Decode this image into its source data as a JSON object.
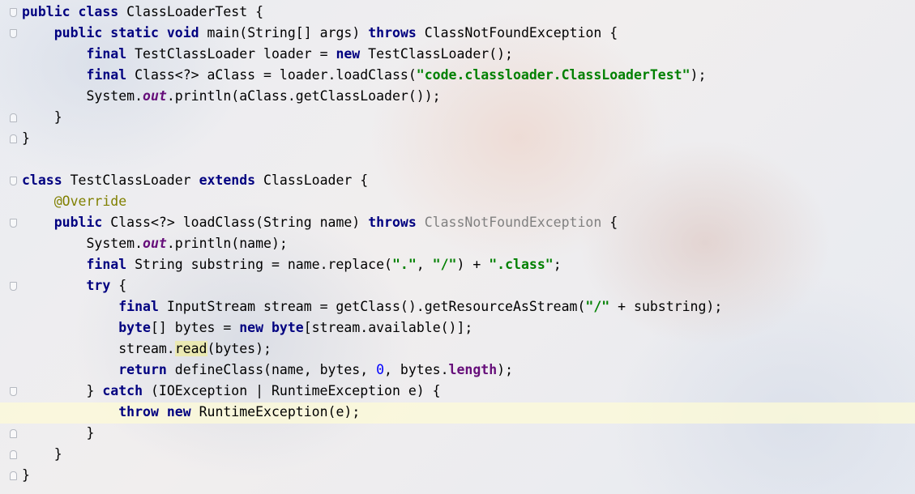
{
  "editor": {
    "highlighted_line": 19,
    "lines": [
      {
        "tokens": [
          {
            "t": "public",
            "c": "kw"
          },
          {
            "t": " "
          },
          {
            "t": "class",
            "c": "kw"
          },
          {
            "t": " ClassLoaderTest {"
          }
        ]
      },
      {
        "tokens": [
          {
            "t": "    "
          },
          {
            "t": "public",
            "c": "kw"
          },
          {
            "t": " "
          },
          {
            "t": "static",
            "c": "kw"
          },
          {
            "t": " "
          },
          {
            "t": "void",
            "c": "kw"
          },
          {
            "t": " main(String[] args) "
          },
          {
            "t": "throws",
            "c": "kw"
          },
          {
            "t": " ClassNotFoundException {"
          }
        ]
      },
      {
        "tokens": [
          {
            "t": "        "
          },
          {
            "t": "final",
            "c": "kw"
          },
          {
            "t": " TestClassLoader loader = "
          },
          {
            "t": "new",
            "c": "kw"
          },
          {
            "t": " TestClassLoader();"
          }
        ]
      },
      {
        "tokens": [
          {
            "t": "        "
          },
          {
            "t": "final",
            "c": "kw"
          },
          {
            "t": " Class<?> aClass = loader.loadClass("
          },
          {
            "t": "\"code.classloader.ClassLoaderTest\"",
            "c": "str"
          },
          {
            "t": ");"
          }
        ]
      },
      {
        "tokens": [
          {
            "t": "        System."
          },
          {
            "t": "out",
            "c": "stat"
          },
          {
            "t": ".println(aClass.getClassLoader());"
          }
        ]
      },
      {
        "tokens": [
          {
            "t": "    }"
          }
        ]
      },
      {
        "tokens": [
          {
            "t": "}"
          }
        ]
      },
      {
        "tokens": []
      },
      {
        "tokens": [
          {
            "t": "class",
            "c": "kw"
          },
          {
            "t": " TestClassLoader "
          },
          {
            "t": "extends",
            "c": "kw"
          },
          {
            "t": " ClassLoader {"
          }
        ]
      },
      {
        "tokens": [
          {
            "t": "    "
          },
          {
            "t": "@Override",
            "c": "ann"
          }
        ]
      },
      {
        "tokens": [
          {
            "t": "    "
          },
          {
            "t": "public",
            "c": "kw"
          },
          {
            "t": " Class<?> loadClass(String name) "
          },
          {
            "t": "throws",
            "c": "kw"
          },
          {
            "t": " "
          },
          {
            "t": "ClassNotFoundException",
            "c": "muted"
          },
          {
            "t": " {"
          }
        ]
      },
      {
        "tokens": [
          {
            "t": "        System."
          },
          {
            "t": "out",
            "c": "stat"
          },
          {
            "t": ".println(name);"
          }
        ]
      },
      {
        "tokens": [
          {
            "t": "        "
          },
          {
            "t": "final",
            "c": "kw"
          },
          {
            "t": " String substring = name.replace("
          },
          {
            "t": "\".\"",
            "c": "str"
          },
          {
            "t": ", "
          },
          {
            "t": "\"/\"",
            "c": "str"
          },
          {
            "t": ") + "
          },
          {
            "t": "\".class\"",
            "c": "str"
          },
          {
            "t": ";"
          }
        ]
      },
      {
        "tokens": [
          {
            "t": "        "
          },
          {
            "t": "try",
            "c": "kw"
          },
          {
            "t": " {"
          }
        ]
      },
      {
        "tokens": [
          {
            "t": "            "
          },
          {
            "t": "final",
            "c": "kw"
          },
          {
            "t": " InputStream stream = getClass().getResourceAsStream("
          },
          {
            "t": "\"/\"",
            "c": "str"
          },
          {
            "t": " + substring);"
          }
        ]
      },
      {
        "tokens": [
          {
            "t": "            "
          },
          {
            "t": "byte",
            "c": "kw"
          },
          {
            "t": "[] bytes = "
          },
          {
            "t": "new",
            "c": "kw"
          },
          {
            "t": " "
          },
          {
            "t": "byte",
            "c": "kw"
          },
          {
            "t": "[stream.available()];"
          }
        ]
      },
      {
        "tokens": [
          {
            "t": "            stream."
          },
          {
            "t": "read",
            "c": "hl"
          },
          {
            "t": "(bytes);"
          }
        ]
      },
      {
        "tokens": [
          {
            "t": "            "
          },
          {
            "t": "return",
            "c": "kw"
          },
          {
            "t": " defineClass(name, bytes, "
          },
          {
            "t": "0",
            "c": "num"
          },
          {
            "t": ", bytes."
          },
          {
            "t": "length",
            "c": "fld"
          },
          {
            "t": ");"
          }
        ]
      },
      {
        "tokens": [
          {
            "t": "        } "
          },
          {
            "t": "catch",
            "c": "kw"
          },
          {
            "t": " (IOException | RuntimeException e) {"
          }
        ]
      },
      {
        "tokens": [
          {
            "t": "            "
          },
          {
            "t": "throw",
            "c": "kw"
          },
          {
            "t": " "
          },
          {
            "t": "new",
            "c": "kw"
          },
          {
            "t": " RuntimeException(e);"
          }
        ]
      },
      {
        "tokens": [
          {
            "t": "        }"
          }
        ]
      },
      {
        "tokens": [
          {
            "t": "    }"
          }
        ]
      },
      {
        "tokens": [
          {
            "t": "}"
          }
        ]
      }
    ]
  },
  "gutter": {
    "fold_markers": [
      {
        "line": 0,
        "kind": "open"
      },
      {
        "line": 1,
        "kind": "open"
      },
      {
        "line": 5,
        "kind": "close"
      },
      {
        "line": 6,
        "kind": "close"
      },
      {
        "line": 8,
        "kind": "open"
      },
      {
        "line": 10,
        "kind": "open"
      },
      {
        "line": 13,
        "kind": "open"
      },
      {
        "line": 18,
        "kind": "open"
      },
      {
        "line": 20,
        "kind": "close"
      },
      {
        "line": 21,
        "kind": "close"
      },
      {
        "line": 22,
        "kind": "close"
      }
    ]
  }
}
